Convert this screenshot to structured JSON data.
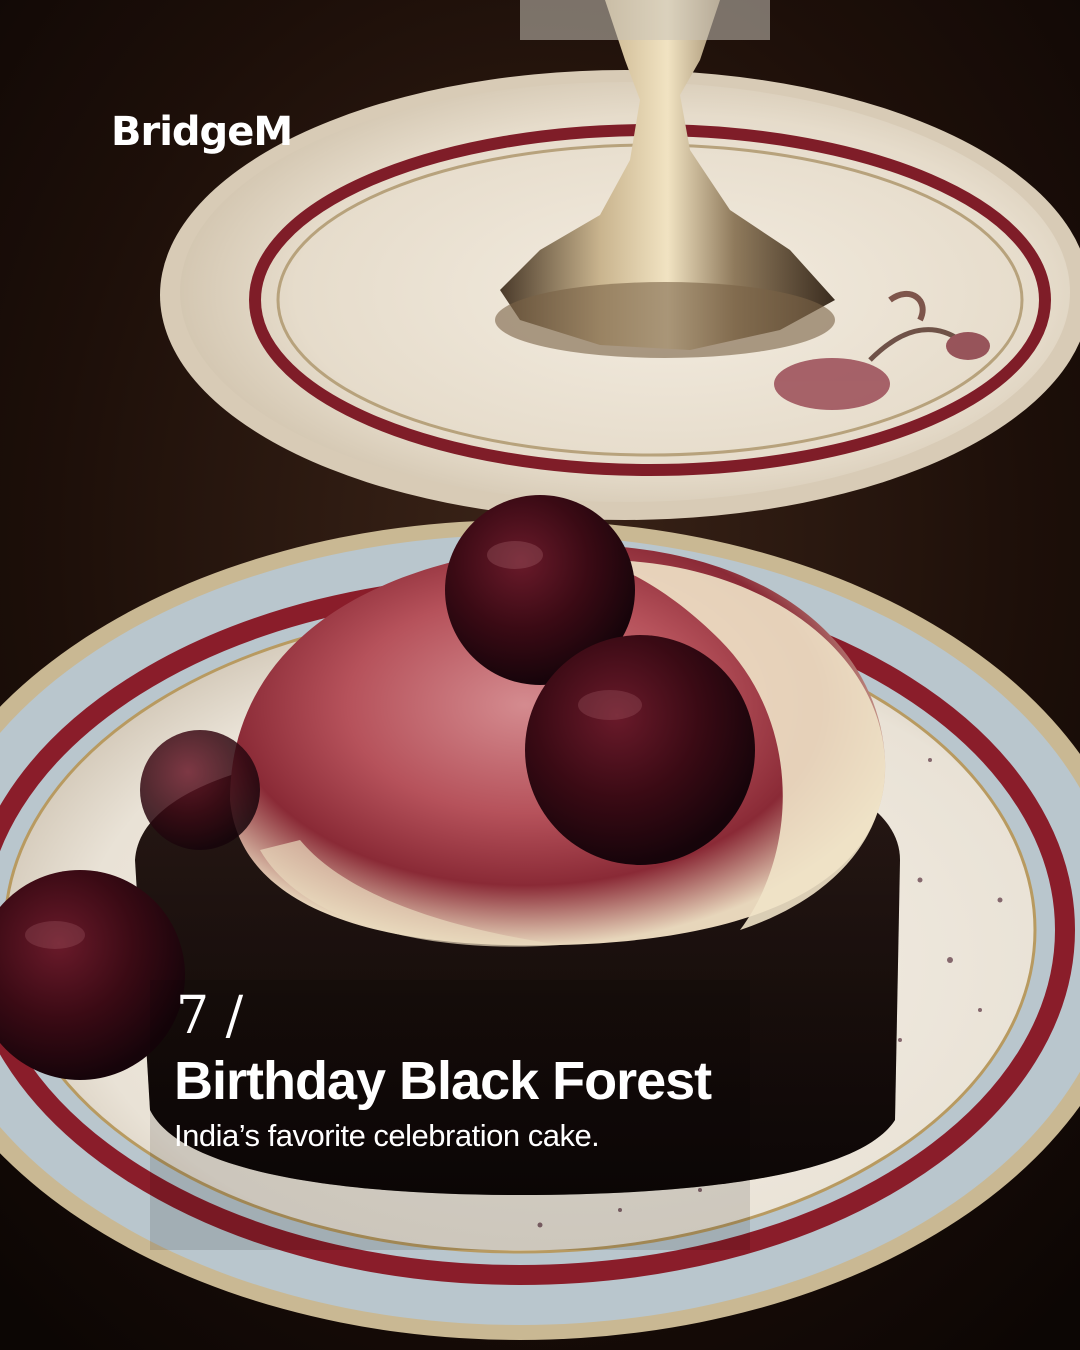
{
  "brand": {
    "name": "BridgeM"
  },
  "slide": {
    "number": "7 /",
    "title": "Birthday Black Forest",
    "subtitle": "India’s favorite celebration cake."
  },
  "colors": {
    "text": "#ffffff",
    "background": "#1a0d08",
    "plate_rim": "#8c1c2a",
    "cream": "#f1e6cf",
    "cherry": "#3c0a14"
  }
}
